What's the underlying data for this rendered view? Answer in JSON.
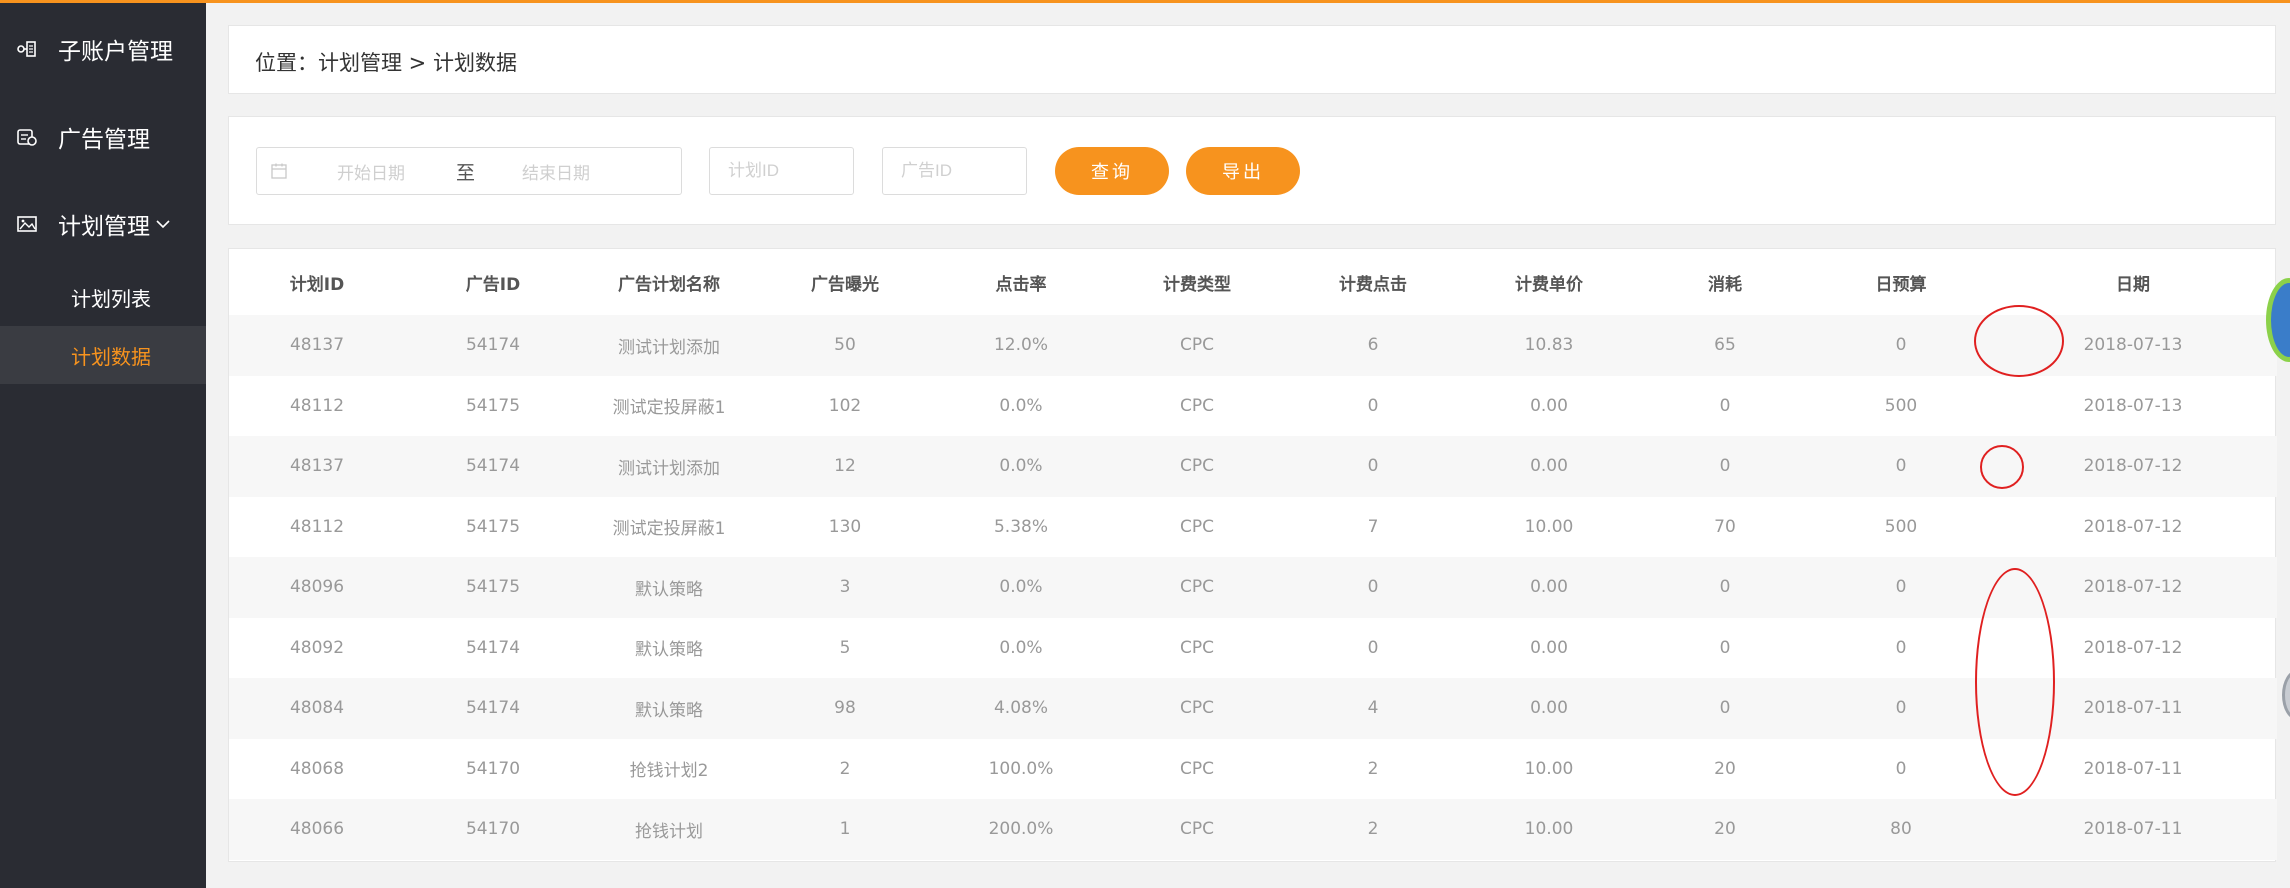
{
  "sidebar": {
    "items": [
      {
        "label": "子账户管理",
        "icon": "sub-account-icon"
      },
      {
        "label": "广告管理",
        "icon": "ad-icon"
      },
      {
        "label": "计划管理",
        "icon": "image-icon"
      }
    ],
    "sub_items": [
      {
        "label": "计划列表",
        "active": false
      },
      {
        "label": "计划数据",
        "active": true
      }
    ]
  },
  "breadcrumb": "位置：计划管理 > 计划数据",
  "filters": {
    "start_placeholder": "开始日期",
    "separator": "至",
    "end_placeholder": "结束日期",
    "plan_id_placeholder": "计划ID",
    "ad_id_placeholder": "广告ID",
    "query_label": "查询",
    "export_label": "导出"
  },
  "table": {
    "headers": [
      "计划ID",
      "广告ID",
      "广告计划名称",
      "广告曝光",
      "点击率",
      "计费类型",
      "计费点击",
      "计费单价",
      "消耗",
      "日预算",
      "日期"
    ],
    "rows": [
      [
        "48137",
        "54174",
        "测试计划添加",
        "50",
        "12.0%",
        "CPC",
        "6",
        "10.83",
        "65",
        "0",
        "2018-07-13"
      ],
      [
        "48112",
        "54175",
        "测试定投屏蔽1",
        "102",
        "0.0%",
        "CPC",
        "0",
        "0.00",
        "0",
        "500",
        "2018-07-13"
      ],
      [
        "48137",
        "54174",
        "测试计划添加",
        "12",
        "0.0%",
        "CPC",
        "0",
        "0.00",
        "0",
        "0",
        "2018-07-12"
      ],
      [
        "48112",
        "54175",
        "测试定投屏蔽1",
        "130",
        "5.38%",
        "CPC",
        "7",
        "10.00",
        "70",
        "500",
        "2018-07-12"
      ],
      [
        "48096",
        "54175",
        "默认策略",
        "3",
        "0.0%",
        "CPC",
        "0",
        "0.00",
        "0",
        "0",
        "2018-07-12"
      ],
      [
        "48092",
        "54174",
        "默认策略",
        "5",
        "0.0%",
        "CPC",
        "0",
        "0.00",
        "0",
        "0",
        "2018-07-12"
      ],
      [
        "48084",
        "54174",
        "默认策略",
        "98",
        "4.08%",
        "CPC",
        "4",
        "0.00",
        "0",
        "0",
        "2018-07-11"
      ],
      [
        "48068",
        "54170",
        "抢钱计划2",
        "2",
        "100.0%",
        "CPC",
        "2",
        "10.00",
        "20",
        "0",
        "2018-07-11"
      ],
      [
        "48066",
        "54170",
        "抢钱计划",
        "1",
        "200.0%",
        "CPC",
        "2",
        "10.00",
        "20",
        "80",
        "2018-07-11"
      ]
    ]
  },
  "colors": {
    "accent": "#f7931e",
    "sidebar_bg": "#2a2c33",
    "annotation": "#e02020"
  }
}
